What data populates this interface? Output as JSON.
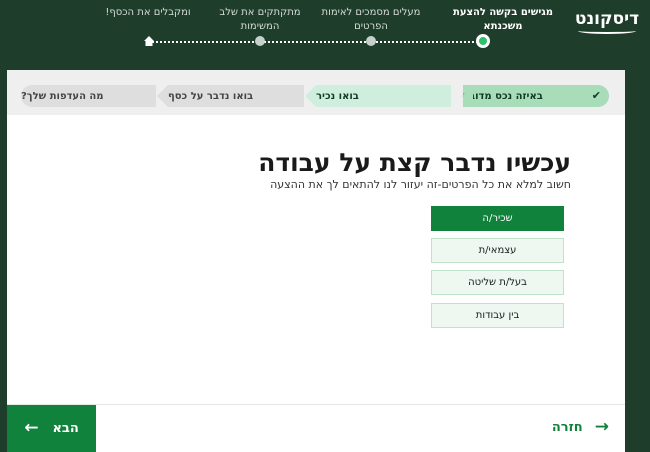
{
  "header": {
    "logo": "דיסקונט",
    "progress_steps": [
      {
        "label": "מגישים בקשה להצעת משכנתא",
        "active": true
      },
      {
        "label": "מעלים מסמכים לאימות הפרטים",
        "active": false
      },
      {
        "label": "מתקתקים את שלב המשימות",
        "active": false
      },
      {
        "label": "ומקבלים את הכסף!",
        "active": false
      }
    ]
  },
  "steps_bar": [
    {
      "label": "באיזה נכס מדובר",
      "state": "done"
    },
    {
      "label": "בואו נכיר",
      "state": "current"
    },
    {
      "label": "בואו נדבר על כסף",
      "state": "todo"
    },
    {
      "label": "מה העדפות שלך?",
      "state": "todo"
    }
  ],
  "main": {
    "title": "עכשיו נדבר קצת על עבודה",
    "subtitle": "חשוב למלא את כל הפרטים-זה יעזור לנו להתאים לך את ההצעה",
    "options": [
      {
        "label": "שכיר/ה",
        "selected": true
      },
      {
        "label": "עצמאי/ת",
        "selected": false
      },
      {
        "label": "בעל/ת שליטה",
        "selected": false
      },
      {
        "label": "בין עבודות",
        "selected": false
      }
    ]
  },
  "footer": {
    "next_label": "הבא",
    "back_label": "חזרה"
  },
  "colors": {
    "header_bg": "#1f3d2b",
    "primary": "#11823b",
    "accent_dot": "#2fbf71"
  }
}
